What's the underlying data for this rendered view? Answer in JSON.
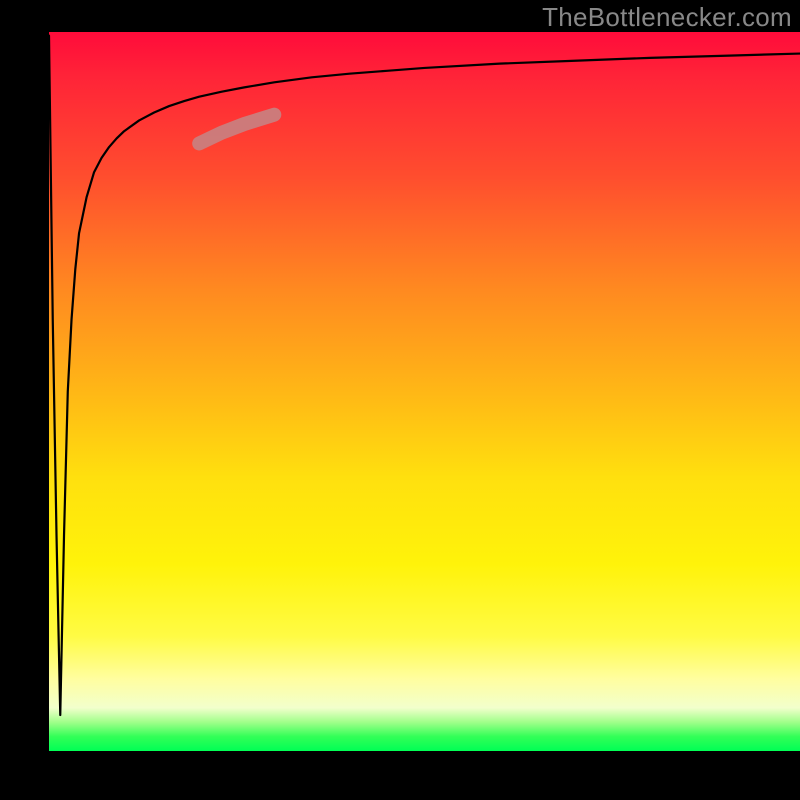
{
  "watermark": {
    "text": "TheBottlenecker.com"
  },
  "colors": {
    "gradient_top": "#ff0b3a",
    "gradient_mid_upper": "#ff8a20",
    "gradient_mid": "#ffe00e",
    "gradient_lower": "#fffb44",
    "gradient_bottom": "#00ff55",
    "frame": "#000000",
    "curve": "#000000",
    "segment": "#c98080"
  },
  "chart_data": {
    "type": "line",
    "title": "",
    "xlabel": "",
    "ylabel": "",
    "xlim": [
      0,
      100
    ],
    "ylim": [
      0,
      100
    ],
    "series": [
      {
        "name": "main-curve",
        "x": [
          0.0,
          0.5,
          1.0,
          1.5,
          2.0,
          2.5,
          3.0,
          3.5,
          4.0,
          5.0,
          6.0,
          7.0,
          8.0,
          9.0,
          10.0,
          12.0,
          14.0,
          16.0,
          18.0,
          20.0,
          23.0,
          26.0,
          30.0,
          35.0,
          40.0,
          45.0,
          50.0,
          60.0,
          70.0,
          80.0,
          90.0,
          100.0
        ],
        "y": [
          99.5,
          60.0,
          30.0,
          5.0,
          30.0,
          50.0,
          60.0,
          67.0,
          72.0,
          77.0,
          80.5,
          82.5,
          84.0,
          85.2,
          86.2,
          87.7,
          88.8,
          89.7,
          90.4,
          91.0,
          91.7,
          92.3,
          93.0,
          93.7,
          94.2,
          94.6,
          95.0,
          95.6,
          96.0,
          96.4,
          96.7,
          97.0
        ]
      },
      {
        "name": "highlight-segment",
        "x": [
          20.0,
          23.0,
          26.0,
          30.0
        ],
        "y": [
          84.5,
          86.0,
          87.2,
          88.5
        ]
      }
    ],
    "annotations": []
  }
}
